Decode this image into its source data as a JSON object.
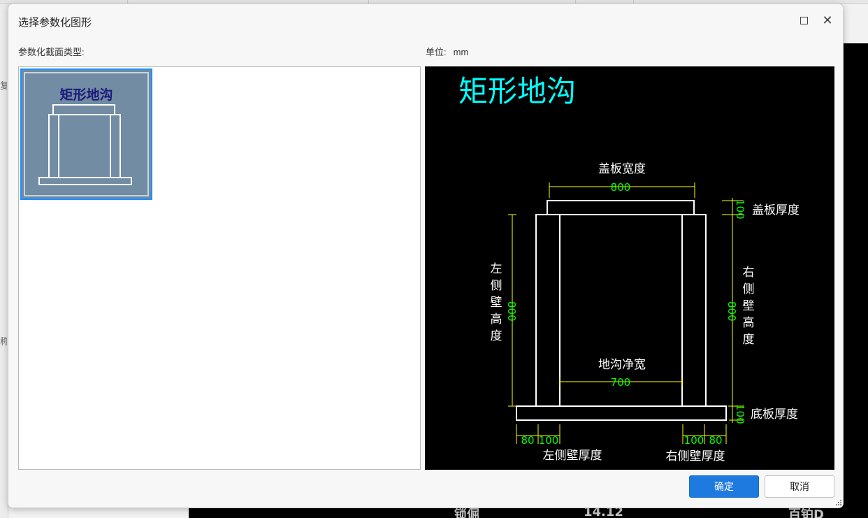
{
  "dialog": {
    "title": "选择参数化图形",
    "section_label": "参数化截面类型:",
    "unit_label": "单位:",
    "unit_value": "mm",
    "ok_button": "确定",
    "cancel_button": "取消"
  },
  "section_list": {
    "items": [
      {
        "label": "矩形地沟",
        "selected": true
      }
    ]
  },
  "preview": {
    "title": "矩形地沟",
    "cover_width_label": "盖板宽度",
    "cover_width_value": "800",
    "cover_thickness_label": "盖板厚度",
    "cover_thickness_value": "100",
    "left_wall_height_label": "左侧壁高度",
    "left_wall_height_value": "800",
    "right_wall_height_label": "右侧壁高度",
    "right_wall_height_value": "800",
    "clear_width_label": "地沟净宽",
    "clear_width_value": "700",
    "base_thickness_label": "底板厚度",
    "base_thickness_value": "100",
    "left_base_ext": "80",
    "left_wall_thickness_value": "100",
    "left_wall_thickness_label": "左侧壁厚度",
    "right_wall_thickness_value": "100",
    "right_base_ext": "80",
    "right_wall_thickness_label": "右侧壁厚度"
  },
  "background": {
    "left_chars": [
      "复",
      "称"
    ],
    "cad_texts": [
      "锁倔",
      "14.12",
      "百铂D"
    ]
  },
  "colors": {
    "accent": "#1f7ae0",
    "preview_title": "#00ffff",
    "dimension": "#ffff00",
    "dim_value": "#00ff00",
    "drawing": "#ffffff",
    "tile_bg": "#718ca3",
    "tile_border": "#1e90ff"
  },
  "icons": [
    "maximize-icon",
    "close-icon",
    "resize-grip-icon"
  ]
}
